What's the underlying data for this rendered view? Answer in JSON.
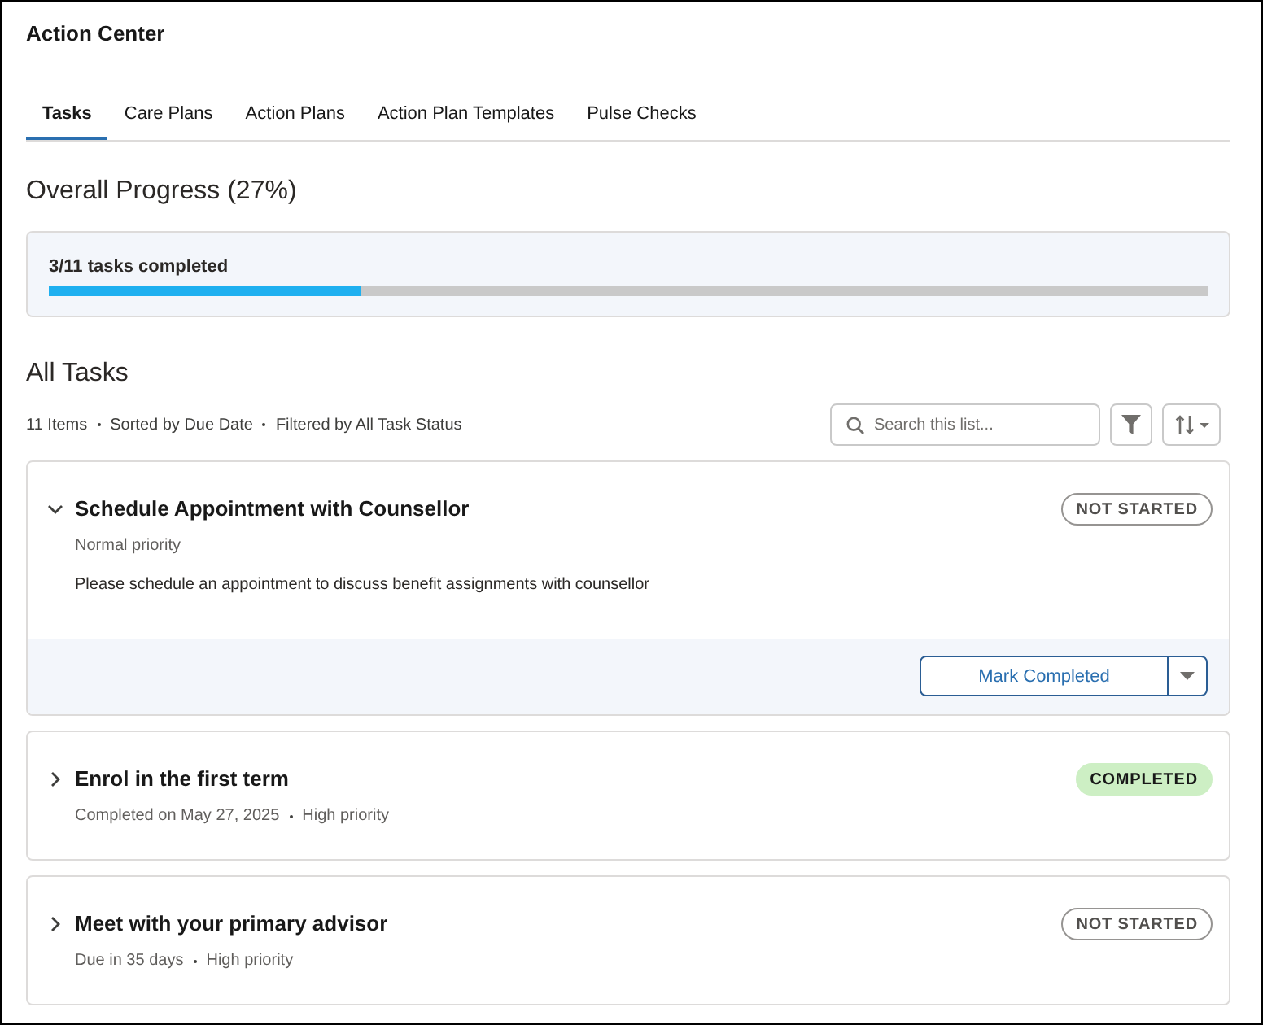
{
  "header": {
    "title": "Action Center"
  },
  "tabs": [
    {
      "label": "Tasks",
      "selected": true
    },
    {
      "label": "Care Plans",
      "selected": false
    },
    {
      "label": "Action Plans",
      "selected": false
    },
    {
      "label": "Action Plan Templates",
      "selected": false
    },
    {
      "label": "Pulse Checks",
      "selected": false
    }
  ],
  "progress": {
    "heading": "Overall Progress (27%)",
    "summary": "3/11 tasks completed",
    "level": 0.27
  },
  "task_list": {
    "heading": "All Tasks",
    "meta": [
      "11 Items",
      "Sorted by Due Date",
      "Filtered by All Task Status"
    ],
    "search": {
      "placeholder": "Search this list..."
    }
  },
  "tasks": [
    {
      "title": "Schedule Appointment with Counsellor",
      "expanded": true,
      "status": {
        "label": "NOT STARTED",
        "kind": "not_started"
      },
      "details": [
        "Normal priority"
      ],
      "description": "Please schedule an appointment to discuss benefit assignments with counsellor",
      "action": "Mark Completed"
    },
    {
      "title": "Enrol in the first term",
      "expanded": false,
      "status": {
        "label": "COMPLETED",
        "kind": "completed"
      },
      "details": [
        "Completed on May 27, 2025",
        "High priority"
      ]
    },
    {
      "title": "Meet with your primary advisor",
      "expanded": false,
      "status": {
        "label": "NOT STARTED",
        "kind": "not_started"
      },
      "details": [
        "Due in 35 days",
        "High priority"
      ]
    }
  ]
}
